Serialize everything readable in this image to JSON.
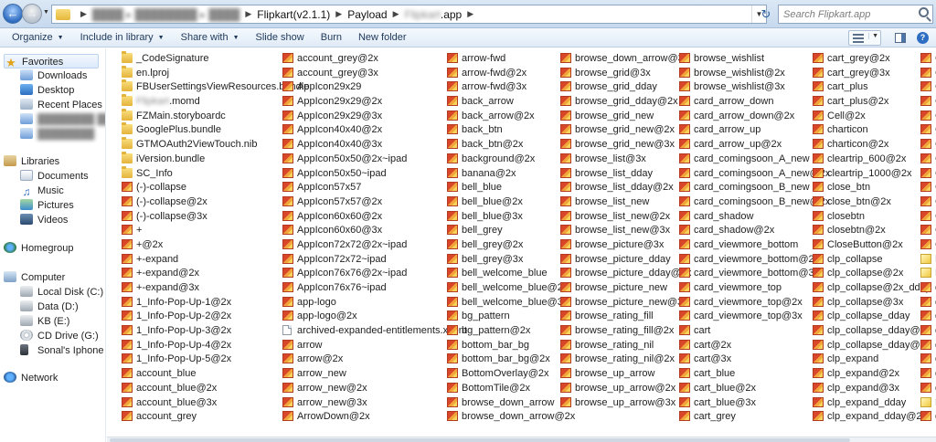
{
  "window": {
    "breadcrumbs": [
      {
        "label": "████ ▸ ████████ ▸ ████",
        "blurred": true
      },
      {
        "label": "Flipkart(v2.1.1)",
        "blurred": false
      },
      {
        "label": "Payload",
        "blurred": false
      },
      {
        "label": "Flipkart.app",
        "blurred": true,
        "suffix": ".app"
      }
    ],
    "path_main": "Flipkart(v2.1.1)",
    "path_payload": "Payload",
    "path_app_suffix": ".app",
    "search_placeholder": "Search Flipkart.app"
  },
  "toolbar": {
    "organize": "Organize",
    "include": "Include in library",
    "share": "Share with",
    "slideshow": "Slide show",
    "burn": "Burn",
    "new_folder": "New folder"
  },
  "nav": {
    "favorites": "Favorites",
    "downloads": "Downloads",
    "desktop": "Desktop",
    "recent": "Recent Places",
    "blur1": "████████ ████████",
    "blur2": "████████",
    "libraries": "Libraries",
    "documents": "Documents",
    "music": "Music",
    "pictures": "Pictures",
    "videos": "Videos",
    "homegroup": "Homegroup",
    "computer": "Computer",
    "local_disk": "Local Disk (C:)",
    "data_d": "Data (D:)",
    "kb_e": "KB (E:)",
    "cd_g": "CD Drive (G:)",
    "iphone": "Sonal's Iphone",
    "network": "Network"
  },
  "columns": [
    {
      "items": [
        {
          "name": "_CodeSignature",
          "icon": "folder"
        },
        {
          "name": "en.lproj",
          "icon": "folder"
        },
        {
          "name": "FBUserSettingsViewResources.bundle",
          "icon": "folder"
        },
        {
          "name": "Flipkart.momd",
          "icon": "folder",
          "blur_prefix": true
        },
        {
          "name": "FZMain.storyboardc",
          "icon": "folder"
        },
        {
          "name": "GooglePlus.bundle",
          "icon": "folder"
        },
        {
          "name": "GTMOAuth2ViewTouch.nib",
          "icon": "folder"
        },
        {
          "name": "iVersion.bundle",
          "icon": "folder"
        },
        {
          "name": "SC_Info",
          "icon": "folder"
        },
        {
          "name": "(-)-collapse",
          "icon": "png"
        },
        {
          "name": "(-)-collapse@2x",
          "icon": "png"
        },
        {
          "name": "(-)-collapse@3x",
          "icon": "png"
        },
        {
          "name": "+",
          "icon": "png"
        },
        {
          "name": "+@2x",
          "icon": "png"
        },
        {
          "name": "+-expand",
          "icon": "png"
        },
        {
          "name": "+-expand@2x",
          "icon": "png"
        },
        {
          "name": "+-expand@3x",
          "icon": "png"
        },
        {
          "name": "1_Info-Pop-Up-1@2x",
          "icon": "png"
        },
        {
          "name": "1_Info-Pop-Up-2@2x",
          "icon": "png"
        },
        {
          "name": "1_Info-Pop-Up-3@2x",
          "icon": "png"
        },
        {
          "name": "1_Info-Pop-Up-4@2x",
          "icon": "png"
        },
        {
          "name": "1_Info-Pop-Up-5@2x",
          "icon": "png"
        },
        {
          "name": "account_blue",
          "icon": "png"
        },
        {
          "name": "account_blue@2x",
          "icon": "png"
        },
        {
          "name": "account_blue@3x",
          "icon": "png"
        },
        {
          "name": "account_grey",
          "icon": "png"
        }
      ]
    },
    {
      "items": [
        {
          "name": "account_grey@2x",
          "icon": "png"
        },
        {
          "name": "account_grey@3x",
          "icon": "png"
        },
        {
          "name": "AppIcon29x29",
          "icon": "png"
        },
        {
          "name": "AppIcon29x29@2x",
          "icon": "png"
        },
        {
          "name": "AppIcon29x29@3x",
          "icon": "png"
        },
        {
          "name": "AppIcon40x40@2x",
          "icon": "png"
        },
        {
          "name": "AppIcon40x40@3x",
          "icon": "png"
        },
        {
          "name": "AppIcon50x50@2x~ipad",
          "icon": "png"
        },
        {
          "name": "AppIcon50x50~ipad",
          "icon": "png"
        },
        {
          "name": "AppIcon57x57",
          "icon": "png"
        },
        {
          "name": "AppIcon57x57@2x",
          "icon": "png"
        },
        {
          "name": "AppIcon60x60@2x",
          "icon": "png"
        },
        {
          "name": "AppIcon60x60@3x",
          "icon": "png"
        },
        {
          "name": "AppIcon72x72@2x~ipad",
          "icon": "png"
        },
        {
          "name": "AppIcon72x72~ipad",
          "icon": "png"
        },
        {
          "name": "AppIcon76x76@2x~ipad",
          "icon": "png"
        },
        {
          "name": "AppIcon76x76~ipad",
          "icon": "png"
        },
        {
          "name": "app-logo",
          "icon": "png"
        },
        {
          "name": "app-logo@2x",
          "icon": "png"
        },
        {
          "name": "archived-expanded-entitlements.xcent",
          "icon": "file"
        },
        {
          "name": "arrow",
          "icon": "png"
        },
        {
          "name": "arrow@2x",
          "icon": "png"
        },
        {
          "name": "arrow_new",
          "icon": "png"
        },
        {
          "name": "arrow_new@2x",
          "icon": "png"
        },
        {
          "name": "arrow_new@3x",
          "icon": "png"
        },
        {
          "name": "ArrowDown@2x",
          "icon": "png"
        }
      ]
    },
    {
      "items": [
        {
          "name": "arrow-fwd",
          "icon": "png"
        },
        {
          "name": "arrow-fwd@2x",
          "icon": "png"
        },
        {
          "name": "arrow-fwd@3x",
          "icon": "png"
        },
        {
          "name": "back_arrow",
          "icon": "png"
        },
        {
          "name": "back_arrow@2x",
          "icon": "png"
        },
        {
          "name": "back_btn",
          "icon": "png"
        },
        {
          "name": "back_btn@2x",
          "icon": "png"
        },
        {
          "name": "background@2x",
          "icon": "png"
        },
        {
          "name": "banana@2x",
          "icon": "png"
        },
        {
          "name": "bell_blue",
          "icon": "png"
        },
        {
          "name": "bell_blue@2x",
          "icon": "png"
        },
        {
          "name": "bell_blue@3x",
          "icon": "png"
        },
        {
          "name": "bell_grey",
          "icon": "png"
        },
        {
          "name": "bell_grey@2x",
          "icon": "png"
        },
        {
          "name": "bell_grey@3x",
          "icon": "png"
        },
        {
          "name": "bell_welcome_blue",
          "icon": "png"
        },
        {
          "name": "bell_welcome_blue@2x",
          "icon": "png"
        },
        {
          "name": "bell_welcome_blue@3x",
          "icon": "png"
        },
        {
          "name": "bg_pattern",
          "icon": "png"
        },
        {
          "name": "bg_pattern@2x",
          "icon": "png"
        },
        {
          "name": "bottom_bar_bg",
          "icon": "png"
        },
        {
          "name": "bottom_bar_bg@2x",
          "icon": "png"
        },
        {
          "name": "BottomOverlay@2x",
          "icon": "png"
        },
        {
          "name": "BottomTile@2x",
          "icon": "png"
        },
        {
          "name": "browse_down_arrow",
          "icon": "png"
        },
        {
          "name": "browse_down_arrow@2x",
          "icon": "png"
        }
      ]
    },
    {
      "items": [
        {
          "name": "browse_down_arrow@3x",
          "icon": "png"
        },
        {
          "name": "browse_grid@3x",
          "icon": "png"
        },
        {
          "name": "browse_grid_dday",
          "icon": "png"
        },
        {
          "name": "browse_grid_dday@2x",
          "icon": "png"
        },
        {
          "name": "browse_grid_new",
          "icon": "png"
        },
        {
          "name": "browse_grid_new@2x",
          "icon": "png"
        },
        {
          "name": "browse_grid_new@3x",
          "icon": "png"
        },
        {
          "name": "browse_list@3x",
          "icon": "png"
        },
        {
          "name": "browse_list_dday",
          "icon": "png"
        },
        {
          "name": "browse_list_dday@2x",
          "icon": "png"
        },
        {
          "name": "browse_list_new",
          "icon": "png"
        },
        {
          "name": "browse_list_new@2x",
          "icon": "png"
        },
        {
          "name": "browse_list_new@3x",
          "icon": "png"
        },
        {
          "name": "browse_picture@3x",
          "icon": "png"
        },
        {
          "name": "browse_picture_dday",
          "icon": "png"
        },
        {
          "name": "browse_picture_dday@2x",
          "icon": "png"
        },
        {
          "name": "browse_picture_new",
          "icon": "png"
        },
        {
          "name": "browse_picture_new@3x",
          "icon": "png"
        },
        {
          "name": "browse_rating_fill",
          "icon": "png"
        },
        {
          "name": "browse_rating_fill@2x",
          "icon": "png"
        },
        {
          "name": "browse_rating_nil",
          "icon": "png"
        },
        {
          "name": "browse_rating_nil@2x",
          "icon": "png"
        },
        {
          "name": "browse_up_arrow",
          "icon": "png"
        },
        {
          "name": "browse_up_arrow@2x",
          "icon": "png"
        },
        {
          "name": "browse_up_arrow@3x",
          "icon": "png"
        }
      ]
    },
    {
      "items": [
        {
          "name": "browse_wishlist",
          "icon": "png"
        },
        {
          "name": "browse_wishlist@2x",
          "icon": "png"
        },
        {
          "name": "browse_wishlist@3x",
          "icon": "png"
        },
        {
          "name": "card_arrow_down",
          "icon": "png"
        },
        {
          "name": "card_arrow_down@2x",
          "icon": "png"
        },
        {
          "name": "card_arrow_up",
          "icon": "png"
        },
        {
          "name": "card_arrow_up@2x",
          "icon": "png"
        },
        {
          "name": "card_comingsoon_A_new",
          "icon": "png"
        },
        {
          "name": "card_comingsoon_A_new@2x",
          "icon": "png"
        },
        {
          "name": "card_comingsoon_B_new",
          "icon": "png"
        },
        {
          "name": "card_comingsoon_B_new@2x",
          "icon": "png"
        },
        {
          "name": "card_shadow",
          "icon": "png"
        },
        {
          "name": "card_shadow@2x",
          "icon": "png"
        },
        {
          "name": "card_viewmore_bottom",
          "icon": "png"
        },
        {
          "name": "card_viewmore_bottom@2x",
          "icon": "png"
        },
        {
          "name": "card_viewmore_bottom@3x",
          "icon": "png"
        },
        {
          "name": "card_viewmore_top",
          "icon": "png"
        },
        {
          "name": "card_viewmore_top@2x",
          "icon": "png"
        },
        {
          "name": "card_viewmore_top@3x",
          "icon": "png"
        },
        {
          "name": "cart",
          "icon": "png"
        },
        {
          "name": "cart@2x",
          "icon": "png"
        },
        {
          "name": "cart@3x",
          "icon": "png"
        },
        {
          "name": "cart_blue",
          "icon": "png"
        },
        {
          "name": "cart_blue@2x",
          "icon": "png"
        },
        {
          "name": "cart_blue@3x",
          "icon": "png"
        },
        {
          "name": "cart_grey",
          "icon": "png"
        }
      ]
    },
    {
      "items": [
        {
          "name": "cart_grey@2x",
          "icon": "png"
        },
        {
          "name": "cart_grey@3x",
          "icon": "png"
        },
        {
          "name": "cart_plus",
          "icon": "png"
        },
        {
          "name": "cart_plus@2x",
          "icon": "png"
        },
        {
          "name": "Cell@2x",
          "icon": "png"
        },
        {
          "name": "charticon",
          "icon": "png"
        },
        {
          "name": "charticon@2x",
          "icon": "png"
        },
        {
          "name": "cleartrip_600@2x",
          "icon": "png"
        },
        {
          "name": "cleartrip_1000@2x",
          "icon": "png"
        },
        {
          "name": "close_btn",
          "icon": "png"
        },
        {
          "name": "close_btn@2x",
          "icon": "png"
        },
        {
          "name": "closebtn",
          "icon": "png"
        },
        {
          "name": "closebtn@2x",
          "icon": "png"
        },
        {
          "name": "CloseButton@2x",
          "icon": "png"
        },
        {
          "name": "clp_collapse",
          "icon": "png"
        },
        {
          "name": "clp_collapse@2x",
          "icon": "png"
        },
        {
          "name": "clp_collapse@2x_dday",
          "icon": "png"
        },
        {
          "name": "clp_collapse@3x",
          "icon": "png"
        },
        {
          "name": "clp_collapse_dday",
          "icon": "png"
        },
        {
          "name": "clp_collapse_dday@2x",
          "icon": "png"
        },
        {
          "name": "clp_collapse_dday@3x",
          "icon": "png"
        },
        {
          "name": "clp_expand",
          "icon": "png"
        },
        {
          "name": "clp_expand@2x",
          "icon": "png"
        },
        {
          "name": "clp_expand@3x",
          "icon": "png"
        },
        {
          "name": "clp_expand_dday",
          "icon": "png"
        },
        {
          "name": "clp_expand_dday@2x",
          "icon": "png"
        }
      ]
    },
    {
      "items": [
        {
          "name": "C",
          "icon": "png"
        },
        {
          "name": "C",
          "icon": "png"
        },
        {
          "name": "C",
          "icon": "png"
        },
        {
          "name": "C",
          "icon": "png"
        },
        {
          "name": "C",
          "icon": "png"
        },
        {
          "name": "C",
          "icon": "png"
        },
        {
          "name": "C",
          "icon": "png"
        },
        {
          "name": "C",
          "icon": "png"
        },
        {
          "name": "C",
          "icon": "png"
        },
        {
          "name": "C",
          "icon": "png"
        },
        {
          "name": "C",
          "icon": "png"
        },
        {
          "name": "C",
          "icon": "png"
        },
        {
          "name": "C",
          "icon": "png"
        },
        {
          "name": "C",
          "icon": "png"
        },
        {
          "name": "D",
          "icon": "note"
        },
        {
          "name": "D",
          "icon": "note"
        },
        {
          "name": "d",
          "icon": "png"
        },
        {
          "name": "d",
          "icon": "png"
        },
        {
          "name": "d",
          "icon": "png"
        },
        {
          "name": "d",
          "icon": "png"
        },
        {
          "name": "d",
          "icon": "png"
        },
        {
          "name": "d",
          "icon": "png"
        },
        {
          "name": "d",
          "icon": "png"
        },
        {
          "name": "d",
          "icon": "png"
        },
        {
          "name": "D",
          "icon": "note"
        },
        {
          "name": "d",
          "icon": "png"
        }
      ]
    }
  ]
}
